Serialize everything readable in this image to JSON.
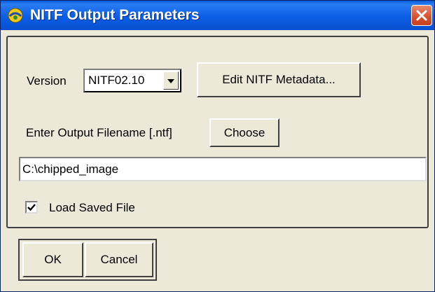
{
  "window": {
    "title": "NITF Output Parameters"
  },
  "version": {
    "label": "Version",
    "selected": "NITF02.10"
  },
  "buttons": {
    "edit_metadata": "Edit NITF Metadata...",
    "choose": "Choose",
    "ok": "OK",
    "cancel": "Cancel"
  },
  "output": {
    "label": "Enter Output Filename [.ntf]",
    "filename": "C:\\chipped_image"
  },
  "load_saved": {
    "label": "Load Saved File",
    "checked": true
  },
  "colors": {
    "titlebar": "#0b5ee6",
    "close_button": "#d5502e",
    "dialog_bg": "#ece9d8"
  }
}
